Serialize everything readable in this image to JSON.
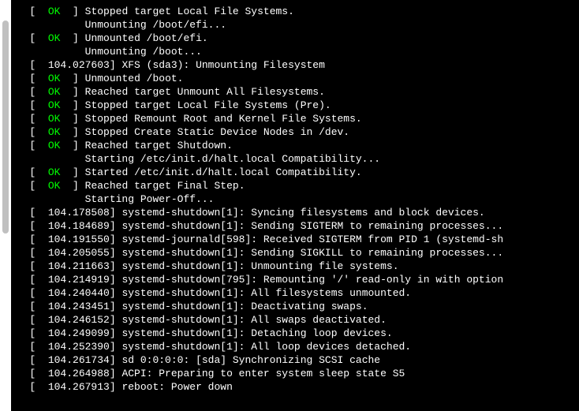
{
  "lines": [
    {
      "type": "ok",
      "text": "Stopped target Local File Systems."
    },
    {
      "type": "ind",
      "text": "Unmounting /boot/efi..."
    },
    {
      "type": "ok",
      "text": "Unmounted /boot/efi."
    },
    {
      "type": "ind",
      "text": "Unmounting /boot..."
    },
    {
      "type": "ts",
      "ts": "104.027603",
      "text": "XFS (sda3): Unmounting Filesystem"
    },
    {
      "type": "ok",
      "text": "Unmounted /boot."
    },
    {
      "type": "ok",
      "text": "Reached target Unmount All Filesystems."
    },
    {
      "type": "ok",
      "text": "Stopped target Local File Systems (Pre)."
    },
    {
      "type": "ok",
      "text": "Stopped Remount Root and Kernel File Systems."
    },
    {
      "type": "ok",
      "text": "Stopped Create Static Device Nodes in /dev."
    },
    {
      "type": "ok",
      "text": "Reached target Shutdown."
    },
    {
      "type": "ind",
      "text": "Starting /etc/init.d/halt.local Compatibility..."
    },
    {
      "type": "ok",
      "text": "Started /etc/init.d/halt.local Compatibility."
    },
    {
      "type": "ok",
      "text": "Reached target Final Step."
    },
    {
      "type": "ind",
      "text": "Starting Power-Off..."
    },
    {
      "type": "ts",
      "ts": "104.178508",
      "text": "systemd-shutdown[1]: Syncing filesystems and block devices."
    },
    {
      "type": "ts",
      "ts": "104.184689",
      "text": "systemd-shutdown[1]: Sending SIGTERM to remaining processes..."
    },
    {
      "type": "ts",
      "ts": "104.191550",
      "text": "systemd-journald[598]: Received SIGTERM from PID 1 (systemd-sh"
    },
    {
      "type": "ts",
      "ts": "104.205055",
      "text": "systemd-shutdown[1]: Sending SIGKILL to remaining processes..."
    },
    {
      "type": "ts",
      "ts": "104.211663",
      "text": "systemd-shutdown[1]: Unmounting file systems."
    },
    {
      "type": "ts",
      "ts": "104.214919",
      "text": "systemd-shutdown[795]: Remounting '/' read-only in with option"
    },
    {
      "type": "ts",
      "ts": "104.240440",
      "text": "systemd-shutdown[1]: All filesystems unmounted."
    },
    {
      "type": "ts",
      "ts": "104.243451",
      "text": "systemd-shutdown[1]: Deactivating swaps."
    },
    {
      "type": "ts",
      "ts": "104.246152",
      "text": "systemd-shutdown[1]: All swaps deactivated."
    },
    {
      "type": "ts",
      "ts": "104.249099",
      "text": "systemd-shutdown[1]: Detaching loop devices."
    },
    {
      "type": "ts",
      "ts": "104.252390",
      "text": "systemd-shutdown[1]: All loop devices detached."
    },
    {
      "type": "ts",
      "ts": "104.261734",
      "text": "sd 0:0:0:0: [sda] Synchronizing SCSI cache"
    },
    {
      "type": "ts",
      "ts": "104.264988",
      "text": "ACPI: Preparing to enter system sleep state S5"
    },
    {
      "type": "ts",
      "ts": "104.267913",
      "text": "reboot: Power down"
    }
  ],
  "ok_label": "OK"
}
